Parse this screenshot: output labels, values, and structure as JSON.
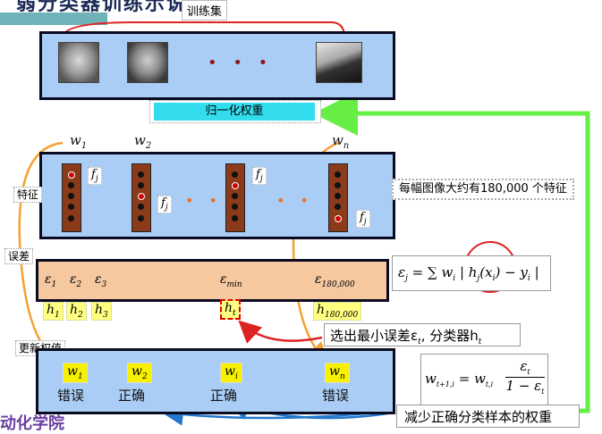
{
  "header": {
    "title_partial": "弱分类器训练示说明",
    "training_set": "训练集"
  },
  "normalize_label": "归一化权重",
  "ellipsis": "• • •",
  "weights_top": [
    {
      "sym": "w",
      "sub": "1"
    },
    {
      "sym": "w",
      "sub": "2"
    },
    {
      "sym": "w",
      "sub": "n"
    }
  ],
  "features": {
    "tag": "特征",
    "symbol": "f",
    "sub": "j",
    "note": "每幅图像大约有180,000 个特征",
    "dots": "• •"
  },
  "errors": {
    "tag": "误差",
    "eps": [
      {
        "sym": "ε",
        "sub": "1"
      },
      {
        "sym": "ε",
        "sub": "2"
      },
      {
        "sym": "ε",
        "sub": "3"
      },
      {
        "sym": "ε",
        "sub": "min"
      },
      {
        "sym": "ε",
        "sub": "180,000"
      }
    ],
    "h": [
      {
        "sym": "h",
        "sub": "1"
      },
      {
        "sym": "h",
        "sub": "2"
      },
      {
        "sym": "h",
        "sub": "3"
      },
      {
        "sym": "h",
        "sub": "t"
      },
      {
        "sym": "h",
        "sub": "180,000"
      }
    ],
    "formula_lhs": "ε",
    "formula_lhs_sub": "j",
    "formula_rhs": "= ∑ w",
    "formula_sum_sub": "i",
    "formula_body": "| h",
    "formula_body2": "(x",
    "formula_body3": ") − y",
    "formula_end": "|"
  },
  "select_note": "选出最小误差ε",
  "select_note_t": "t",
  "select_note_tail": ", 分类器h",
  "update": {
    "tag": "更新权值",
    "weights": [
      {
        "sym": "w",
        "sub": "1",
        "status": "错误"
      },
      {
        "sym": "w",
        "sub": "2",
        "status": "正确"
      },
      {
        "sym": "w",
        "sub": "i",
        "status": "正确"
      },
      {
        "sym": "w",
        "sub": "n",
        "status": "错误"
      }
    ],
    "formula": "w",
    "formula_sub": "t+1,i",
    "formula_mid": "= w",
    "formula_mid_sub": "t,i",
    "frac_num": "ε",
    "frac_num_sub": "t",
    "frac_den": "1 − ε",
    "frac_den_sub": "t"
  },
  "reduce_note": "减少正确分类样本的权重",
  "footer_partial": "动化学院",
  "colors": {
    "panel_blue": "#a9cdf5",
    "error_orange": "#f5c8a0",
    "normalize_cyan": "#33ddee",
    "arrow_green": "#66ee44",
    "arrow_orange": "#f5a030",
    "arrow_red": "#dd2222",
    "arrow_blue": "#2277cc",
    "feature_brown": "#8b3a1a"
  }
}
